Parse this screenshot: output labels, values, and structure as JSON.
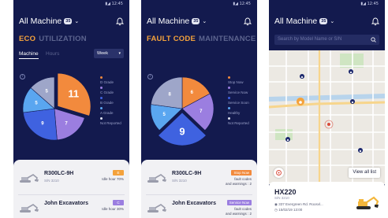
{
  "status_time": "12:45",
  "screens": [
    {
      "header": {
        "title": "All Machine",
        "count": "35",
        "chevron": "⌄"
      },
      "tabs": {
        "active": "ECO",
        "inactive": "UTILIZATION"
      },
      "subtabs": {
        "active": "Machine",
        "inactive": "Hours",
        "dropdown": "Week",
        "caret": "▾"
      },
      "info": "i",
      "pie": [
        {
          "label": "11",
          "value": 11,
          "color": "#f28a3d"
        },
        {
          "label": "7",
          "value": 7,
          "color": "#9b7ee0"
        },
        {
          "label": "9",
          "value": 9,
          "color": "#3f62e0"
        },
        {
          "label": "5",
          "value": 5,
          "color": "#5aa6f0"
        },
        {
          "label": "5",
          "value": 5,
          "color": "#9ea6c9"
        }
      ],
      "legend": [
        {
          "label": "D Grade",
          "color": "#f28a3d"
        },
        {
          "label": "C Grade",
          "color": "#9b7ee0"
        },
        {
          "label": "B Grade",
          "color": "#3f62e0"
        },
        {
          "label": "A Grade",
          "color": "#5aa6f0"
        },
        {
          "label": "Not Reported",
          "color": "#e0e2ee"
        }
      ],
      "rows": [
        {
          "model": "R300LC-9H",
          "sn": "S/N 3210",
          "badge": "E",
          "badge_color": "#f4a23c",
          "sub1": "Idle hour 70%",
          "sub2": ""
        },
        {
          "model": "John Excavators",
          "sn": "",
          "badge": "C",
          "badge_color": "#9b7ee0",
          "sub1": "Idle hour 30%",
          "sub2": ""
        }
      ]
    },
    {
      "header": {
        "title": "All Machine",
        "count": "35",
        "chevron": "⌄"
      },
      "tabs": {
        "active": "FAULT CODE",
        "inactive": "MAINTENANCE"
      },
      "info": "i",
      "pie": [
        {
          "label": "6",
          "value": 6,
          "color": "#f28a3d"
        },
        {
          "label": "7",
          "value": 7,
          "color": "#9b7ee0"
        },
        {
          "label": "9",
          "value": 9,
          "color": "#3f62e0"
        },
        {
          "label": "5",
          "value": 5,
          "color": "#5aa6f0"
        },
        {
          "label": "8",
          "value": 8,
          "color": "#9ea6c9"
        }
      ],
      "legend": [
        {
          "label": "Stop Now",
          "color": "#f28a3d"
        },
        {
          "label": "Service Now",
          "color": "#9b7ee0"
        },
        {
          "label": "Service Soon",
          "color": "#3f62e0"
        },
        {
          "label": "Healthy",
          "color": "#5aa6f0"
        },
        {
          "label": "Not Reported",
          "color": "#e0e2ee"
        }
      ],
      "rows": [
        {
          "model": "R300LC-9H",
          "sn": "S/N 3210",
          "badge": "Stop Now",
          "badge_color": "#f28a3d",
          "sub1": "fault codes",
          "sub2": "and warnings : 2"
        },
        {
          "model": "John Excavators",
          "sn": "",
          "badge": "Service Now",
          "badge_color": "#9b7ee0",
          "sub1": "fault codes",
          "sub2": "and warnings : 2"
        }
      ]
    },
    {
      "header": {
        "title": "All Machine",
        "count": "35",
        "chevron": "⌄"
      },
      "search": {
        "placeholder": "Search by Model Name or S/N"
      },
      "map": {
        "view_all": "View all list"
      },
      "detail": {
        "name": "HX220",
        "sn": "S/N 3210",
        "address": "337 Evergreen Rd. Roosvl...",
        "datetime": "15/02/19 13:00"
      },
      "colors": {
        "pin": "#1e2a6e",
        "selected": "#f4a23c",
        "alert": "#d94a3a",
        "road": "#ffffff",
        "highway": "#f7d58c",
        "water": "#b8d4ec",
        "park": "#cfe5c2"
      }
    }
  ]
}
